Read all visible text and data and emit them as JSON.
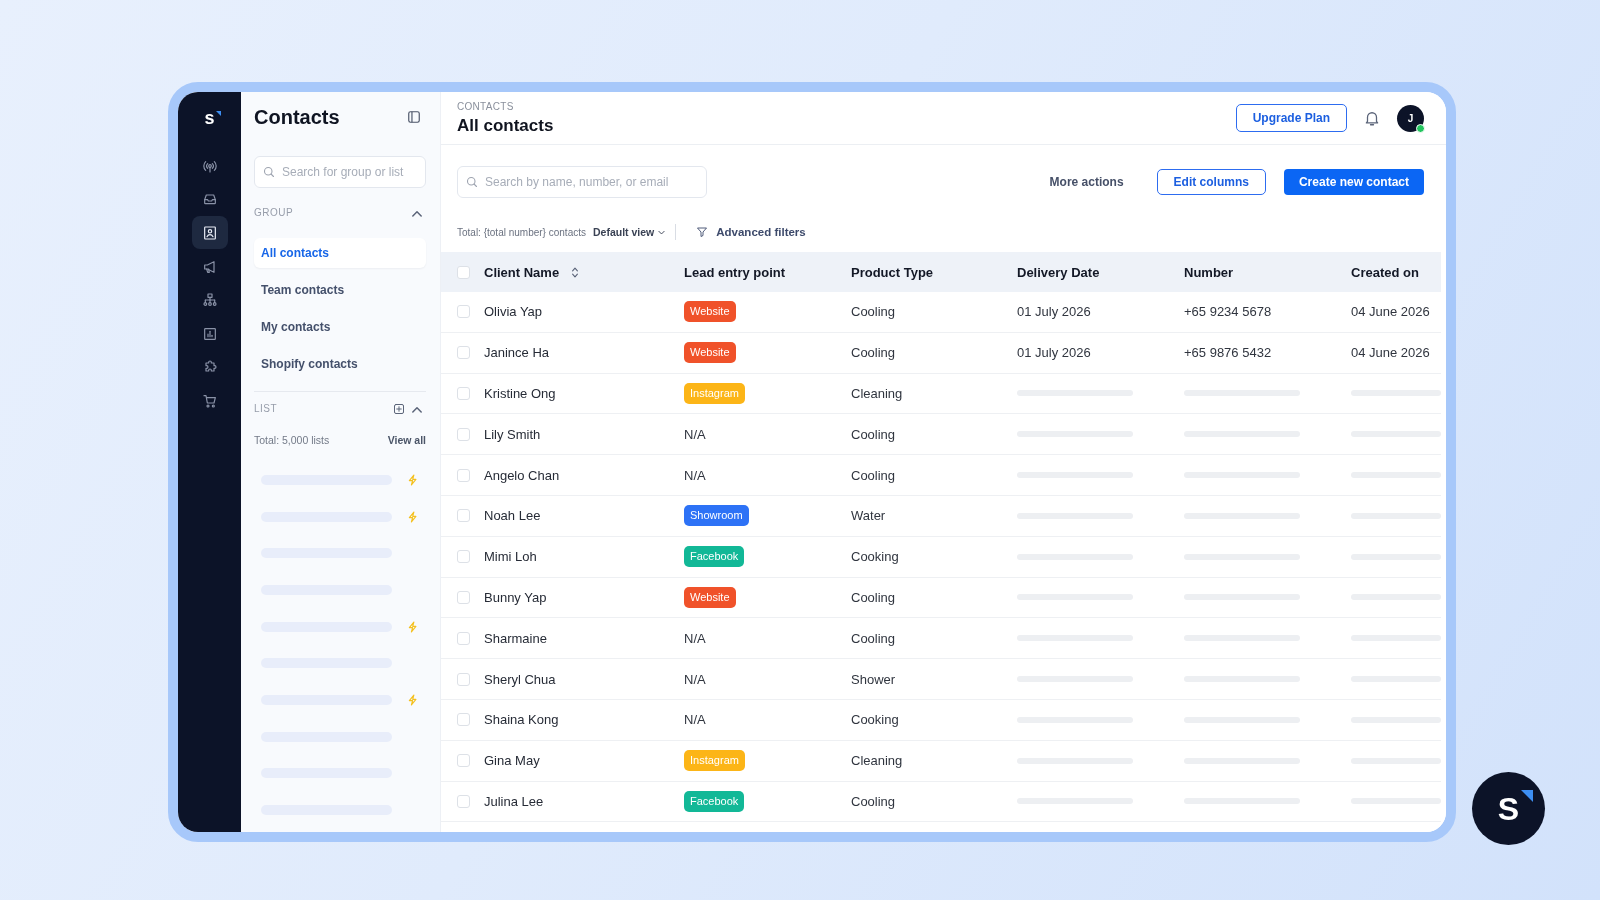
{
  "rail": {
    "logo": "s",
    "items": [
      {
        "selected": false
      },
      {
        "selected": false
      },
      {
        "selected": true
      },
      {
        "selected": false
      },
      {
        "selected": false
      },
      {
        "selected": false
      },
      {
        "selected": false
      },
      {
        "selected": false
      }
    ]
  },
  "sidebar": {
    "title": "Contacts",
    "search": {
      "placeholder": "Search for group or list"
    },
    "group": {
      "label": "GROUP",
      "expanded": true,
      "items": [
        {
          "label": "All contacts",
          "selected": true
        },
        {
          "label": "Team contacts",
          "selected": false
        },
        {
          "label": "My contacts",
          "selected": false
        },
        {
          "label": "Shopify contacts",
          "selected": false
        }
      ]
    },
    "list": {
      "label": "LIST",
      "expanded": true,
      "total": "Total: 5,000 lists",
      "view_all": "View all",
      "items": [
        {
          "loading": true,
          "lightning": true
        },
        {
          "loading": true,
          "lightning": true
        },
        {
          "loading": true,
          "lightning": false
        },
        {
          "loading": true,
          "lightning": false
        },
        {
          "loading": true,
          "lightning": true
        },
        {
          "loading": true,
          "lightning": false
        },
        {
          "loading": true,
          "lightning": true
        },
        {
          "loading": true,
          "lightning": false
        },
        {
          "loading": true,
          "lightning": false
        },
        {
          "loading": true,
          "lightning": false
        }
      ]
    }
  },
  "header": {
    "breadcrumb": "CONTACTS",
    "title": "All contacts",
    "upgrade_button": "Upgrade Plan",
    "avatar": {
      "initial": "J",
      "online": true
    }
  },
  "toolbar": {
    "search": {
      "placeholder": "Search by name, number, or email"
    },
    "more_actions": "More actions",
    "edit_columns": "Edit columns",
    "create_button": "Create new contact"
  },
  "filters": {
    "total": "Total: {total number} contacts",
    "view": "Default view",
    "advanced_filters": "Advanced filters"
  },
  "table": {
    "select_all_checked": false,
    "columns": [
      {
        "label": "Client Name",
        "sortable": true
      },
      {
        "label": "Lead entry point",
        "sortable": false
      },
      {
        "label": "Product Type",
        "sortable": false
      },
      {
        "label": "Delivery Date",
        "sortable": false
      },
      {
        "label": "Number",
        "sortable": false
      },
      {
        "label": "Created on",
        "sortable": false
      }
    ],
    "rows": [
      {
        "name": "Olivia Yap",
        "checked": false,
        "lead": {
          "kind": "badge",
          "text": "Website",
          "color": "#f0522a"
        },
        "product": "Cooling",
        "loading": false,
        "delivery_date": "01 July 2026",
        "number": "+65 9234 5678",
        "created_on": "04 June 2026"
      },
      {
        "name": "Janince Ha",
        "checked": false,
        "lead": {
          "kind": "badge",
          "text": "Website",
          "color": "#f0522a"
        },
        "product": "Cooling",
        "loading": false,
        "delivery_date": "01 July 2026",
        "number": "+65 9876 5432",
        "created_on": "04 June 2026"
      },
      {
        "name": "Kristine Ong",
        "checked": false,
        "lead": {
          "kind": "badge",
          "text": "Instagram",
          "color": "#fcb517"
        },
        "product": "Cleaning",
        "loading": true
      },
      {
        "name": "Lily Smith",
        "checked": false,
        "lead": {
          "kind": "text",
          "text": "N/A"
        },
        "product": "Cooling",
        "loading": true
      },
      {
        "name": "Angelo Chan",
        "checked": false,
        "lead": {
          "kind": "text",
          "text": "N/A"
        },
        "product": "Cooling",
        "loading": true
      },
      {
        "name": "Noah Lee",
        "checked": false,
        "lead": {
          "kind": "badge",
          "text": "Showroom",
          "color": "#2d72f6"
        },
        "product": "Water",
        "loading": true
      },
      {
        "name": "Mimi Loh",
        "checked": false,
        "lead": {
          "kind": "badge",
          "text": "Facebook",
          "color": "#12b897"
        },
        "product": "Cooking",
        "loading": true
      },
      {
        "name": "Bunny Yap",
        "checked": false,
        "lead": {
          "kind": "badge",
          "text": "Website",
          "color": "#f0522a"
        },
        "product": "Cooling",
        "loading": true
      },
      {
        "name": "Sharmaine",
        "checked": false,
        "lead": {
          "kind": "text",
          "text": "N/A"
        },
        "product": "Cooling",
        "loading": true
      },
      {
        "name": "Sheryl Chua",
        "checked": false,
        "lead": {
          "kind": "text",
          "text": "N/A"
        },
        "product": "Shower",
        "loading": true
      },
      {
        "name": "Shaina Kong",
        "checked": false,
        "lead": {
          "kind": "text",
          "text": "N/A"
        },
        "product": "Cooking",
        "loading": true
      },
      {
        "name": "Gina May",
        "checked": false,
        "lead": {
          "kind": "badge",
          "text": "Instagram",
          "color": "#fcb517"
        },
        "product": "Cleaning",
        "loading": true
      },
      {
        "name": "Julina Lee",
        "checked": false,
        "lead": {
          "kind": "badge",
          "text": "Facebook",
          "color": "#12b897"
        },
        "product": "Cooling",
        "loading": true
      }
    ]
  },
  "brand_badge": {
    "letter": "S"
  }
}
